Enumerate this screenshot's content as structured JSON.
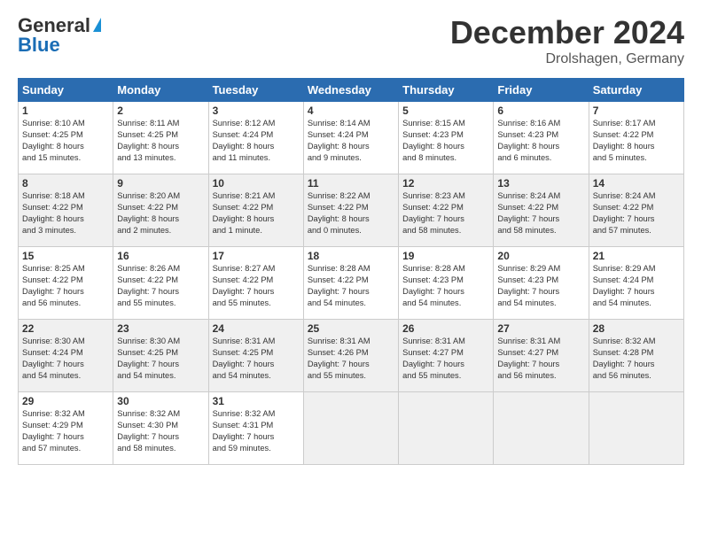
{
  "header": {
    "logo_general": "General",
    "logo_blue": "Blue",
    "title": "December 2024",
    "subtitle": "Drolshagen, Germany"
  },
  "days_of_week": [
    "Sunday",
    "Monday",
    "Tuesday",
    "Wednesday",
    "Thursday",
    "Friday",
    "Saturday"
  ],
  "weeks": [
    [
      {
        "day": "1",
        "lines": [
          "Sunrise: 8:10 AM",
          "Sunset: 4:25 PM",
          "Daylight: 8 hours",
          "and 15 minutes."
        ]
      },
      {
        "day": "2",
        "lines": [
          "Sunrise: 8:11 AM",
          "Sunset: 4:25 PM",
          "Daylight: 8 hours",
          "and 13 minutes."
        ]
      },
      {
        "day": "3",
        "lines": [
          "Sunrise: 8:12 AM",
          "Sunset: 4:24 PM",
          "Daylight: 8 hours",
          "and 11 minutes."
        ]
      },
      {
        "day": "4",
        "lines": [
          "Sunrise: 8:14 AM",
          "Sunset: 4:24 PM",
          "Daylight: 8 hours",
          "and 9 minutes."
        ]
      },
      {
        "day": "5",
        "lines": [
          "Sunrise: 8:15 AM",
          "Sunset: 4:23 PM",
          "Daylight: 8 hours",
          "and 8 minutes."
        ]
      },
      {
        "day": "6",
        "lines": [
          "Sunrise: 8:16 AM",
          "Sunset: 4:23 PM",
          "Daylight: 8 hours",
          "and 6 minutes."
        ]
      },
      {
        "day": "7",
        "lines": [
          "Sunrise: 8:17 AM",
          "Sunset: 4:22 PM",
          "Daylight: 8 hours",
          "and 5 minutes."
        ]
      }
    ],
    [
      {
        "day": "8",
        "lines": [
          "Sunrise: 8:18 AM",
          "Sunset: 4:22 PM",
          "Daylight: 8 hours",
          "and 3 minutes."
        ]
      },
      {
        "day": "9",
        "lines": [
          "Sunrise: 8:20 AM",
          "Sunset: 4:22 PM",
          "Daylight: 8 hours",
          "and 2 minutes."
        ]
      },
      {
        "day": "10",
        "lines": [
          "Sunrise: 8:21 AM",
          "Sunset: 4:22 PM",
          "Daylight: 8 hours",
          "and 1 minute."
        ]
      },
      {
        "day": "11",
        "lines": [
          "Sunrise: 8:22 AM",
          "Sunset: 4:22 PM",
          "Daylight: 8 hours",
          "and 0 minutes."
        ]
      },
      {
        "day": "12",
        "lines": [
          "Sunrise: 8:23 AM",
          "Sunset: 4:22 PM",
          "Daylight: 7 hours",
          "and 58 minutes."
        ]
      },
      {
        "day": "13",
        "lines": [
          "Sunrise: 8:24 AM",
          "Sunset: 4:22 PM",
          "Daylight: 7 hours",
          "and 58 minutes."
        ]
      },
      {
        "day": "14",
        "lines": [
          "Sunrise: 8:24 AM",
          "Sunset: 4:22 PM",
          "Daylight: 7 hours",
          "and 57 minutes."
        ]
      }
    ],
    [
      {
        "day": "15",
        "lines": [
          "Sunrise: 8:25 AM",
          "Sunset: 4:22 PM",
          "Daylight: 7 hours",
          "and 56 minutes."
        ]
      },
      {
        "day": "16",
        "lines": [
          "Sunrise: 8:26 AM",
          "Sunset: 4:22 PM",
          "Daylight: 7 hours",
          "and 55 minutes."
        ]
      },
      {
        "day": "17",
        "lines": [
          "Sunrise: 8:27 AM",
          "Sunset: 4:22 PM",
          "Daylight: 7 hours",
          "and 55 minutes."
        ]
      },
      {
        "day": "18",
        "lines": [
          "Sunrise: 8:28 AM",
          "Sunset: 4:22 PM",
          "Daylight: 7 hours",
          "and 54 minutes."
        ]
      },
      {
        "day": "19",
        "lines": [
          "Sunrise: 8:28 AM",
          "Sunset: 4:23 PM",
          "Daylight: 7 hours",
          "and 54 minutes."
        ]
      },
      {
        "day": "20",
        "lines": [
          "Sunrise: 8:29 AM",
          "Sunset: 4:23 PM",
          "Daylight: 7 hours",
          "and 54 minutes."
        ]
      },
      {
        "day": "21",
        "lines": [
          "Sunrise: 8:29 AM",
          "Sunset: 4:24 PM",
          "Daylight: 7 hours",
          "and 54 minutes."
        ]
      }
    ],
    [
      {
        "day": "22",
        "lines": [
          "Sunrise: 8:30 AM",
          "Sunset: 4:24 PM",
          "Daylight: 7 hours",
          "and 54 minutes."
        ]
      },
      {
        "day": "23",
        "lines": [
          "Sunrise: 8:30 AM",
          "Sunset: 4:25 PM",
          "Daylight: 7 hours",
          "and 54 minutes."
        ]
      },
      {
        "day": "24",
        "lines": [
          "Sunrise: 8:31 AM",
          "Sunset: 4:25 PM",
          "Daylight: 7 hours",
          "and 54 minutes."
        ]
      },
      {
        "day": "25",
        "lines": [
          "Sunrise: 8:31 AM",
          "Sunset: 4:26 PM",
          "Daylight: 7 hours",
          "and 55 minutes."
        ]
      },
      {
        "day": "26",
        "lines": [
          "Sunrise: 8:31 AM",
          "Sunset: 4:27 PM",
          "Daylight: 7 hours",
          "and 55 minutes."
        ]
      },
      {
        "day": "27",
        "lines": [
          "Sunrise: 8:31 AM",
          "Sunset: 4:27 PM",
          "Daylight: 7 hours",
          "and 56 minutes."
        ]
      },
      {
        "day": "28",
        "lines": [
          "Sunrise: 8:32 AM",
          "Sunset: 4:28 PM",
          "Daylight: 7 hours",
          "and 56 minutes."
        ]
      }
    ],
    [
      {
        "day": "29",
        "lines": [
          "Sunrise: 8:32 AM",
          "Sunset: 4:29 PM",
          "Daylight: 7 hours",
          "and 57 minutes."
        ]
      },
      {
        "day": "30",
        "lines": [
          "Sunrise: 8:32 AM",
          "Sunset: 4:30 PM",
          "Daylight: 7 hours",
          "and 58 minutes."
        ]
      },
      {
        "day": "31",
        "lines": [
          "Sunrise: 8:32 AM",
          "Sunset: 4:31 PM",
          "Daylight: 7 hours",
          "and 59 minutes."
        ]
      },
      {
        "day": "",
        "lines": []
      },
      {
        "day": "",
        "lines": []
      },
      {
        "day": "",
        "lines": []
      },
      {
        "day": "",
        "lines": []
      }
    ]
  ]
}
